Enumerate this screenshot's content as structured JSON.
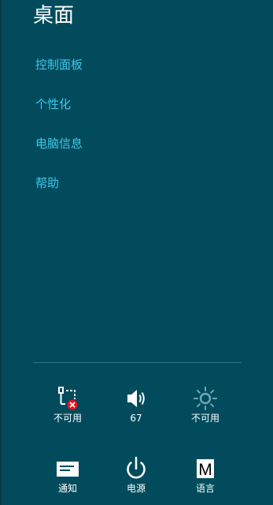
{
  "charms": {
    "title": "桌面",
    "menu_items": [
      {
        "label": "控制面板"
      },
      {
        "label": "个性化"
      },
      {
        "label": "电脑信息"
      },
      {
        "label": "帮助"
      }
    ]
  },
  "quick_settings": {
    "network": {
      "icon": "network-unavailable-icon",
      "label": "不可用"
    },
    "volume": {
      "icon": "speaker-icon",
      "label": "67"
    },
    "brightness": {
      "icon": "brightness-sun-icon",
      "label": "不可用"
    },
    "notifications": {
      "icon": "notifications-icon",
      "label": "通知"
    },
    "power": {
      "icon": "power-icon",
      "label": "电源"
    },
    "language": {
      "icon": "language-m-icon",
      "glyph": "M",
      "label": "语言"
    }
  },
  "colors": {
    "background": "#014b5d",
    "link": "#3fc8e8",
    "text": "#ffffff",
    "error_badge": "#e81123",
    "disabled_icon": "#6fa7b5"
  }
}
